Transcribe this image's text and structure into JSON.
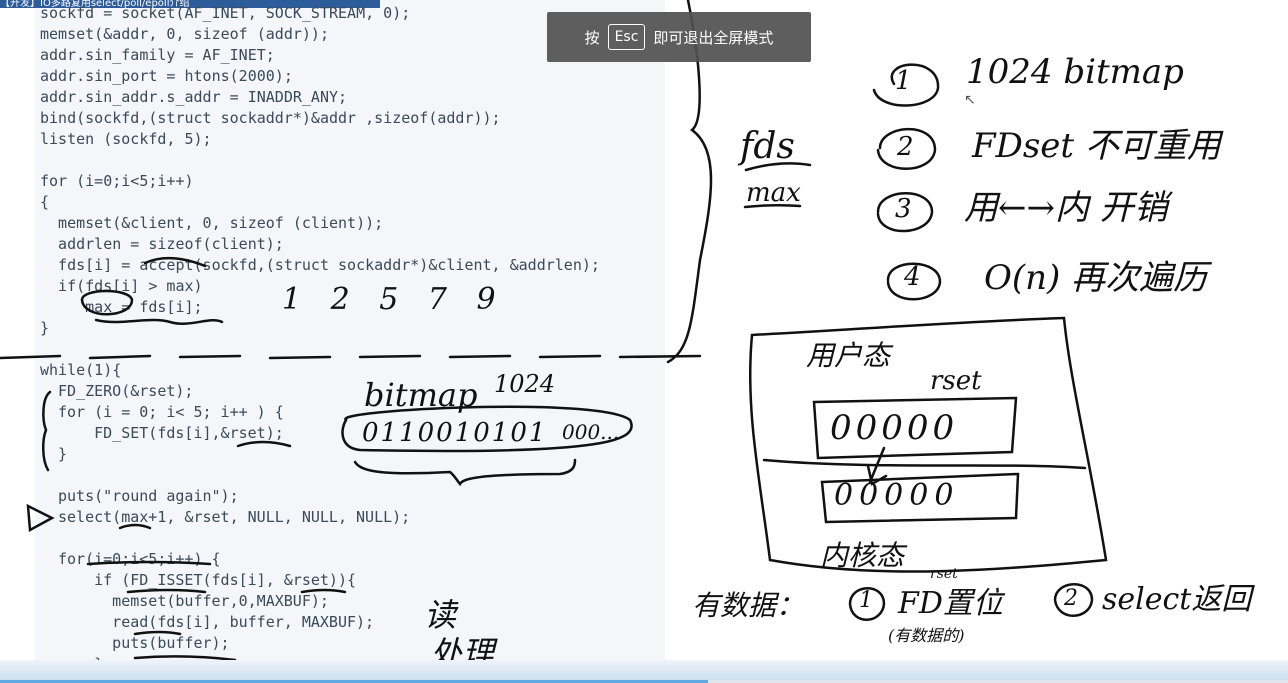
{
  "title_strip": "【开发】IO多路复用select/poll/epoll介绍",
  "esc_banner": {
    "prefix": "按",
    "key": "Esc",
    "suffix": "即可退出全屏模式"
  },
  "code": [
    "sockfd = socket(AF_INET, SOCK_STREAM, 0);",
    "memset(&addr, 0, sizeof (addr));",
    "addr.sin_family = AF_INET;",
    "addr.sin_port = htons(2000);",
    "addr.sin_addr.s_addr = INADDR_ANY;",
    "bind(sockfd,(struct sockaddr*)&addr ,sizeof(addr));",
    "listen (sockfd, 5);",
    "for (i=0;i<5;i++)",
    "{",
    "  memset(&client, 0, sizeof (client));",
    "  addrlen = sizeof(client);",
    "  fds[i] = accept(sockfd,(struct sockaddr*)&client, &addrlen);",
    "  if(fds[i] > max)",
    "     max = fds[i];",
    "}",
    "while(1){",
    "FD_ZERO(&rset);",
    "for (i = 0; i< 5; i++ ) {",
    "    FD_SET(fds[i],&rset);",
    "}",
    "puts(\"round again\");",
    "select(max+1, &rset, NULL, NULL, NULL);",
    "for(i=0;i<5;i++) {",
    "    if (FD_ISSET(fds[i], &rset)){",
    "      memset(buffer,0,MAXBUF);",
    "      read(fds[i], buffer, MAXBUF);",
    "      puts(buffer);",
    "    }"
  ],
  "notes": {
    "nums": "1 2 5 7 9",
    "bitmap_label": "bitmap",
    "bitmap_size": "1024",
    "bitmap_bits": "0110010101",
    "bitmap_rest": "000...",
    "fds": "fds",
    "max": "max",
    "item1_num": "1",
    "item1": "1024 bitmap",
    "item2_num": "2",
    "item2": "FDset 不可重用",
    "item3_num": "3",
    "item3": "用←→内 开销",
    "item4_num": "4",
    "item4": "O(n) 再次遍历",
    "user_mode": "用户态",
    "rset": "rset",
    "user_bits": "00000",
    "kernel_bits": "00000",
    "kernel_mode": "内核态",
    "has_data": "有数据：",
    "step1_num": "1",
    "step1": "FD置位",
    "step1_sup": "rset",
    "step1_sub": "(有数据的)",
    "step2_num": "2",
    "step2": "select返回",
    "read_label": "读",
    "process_label": "处理"
  },
  "progress": {
    "value_percent": 55
  }
}
